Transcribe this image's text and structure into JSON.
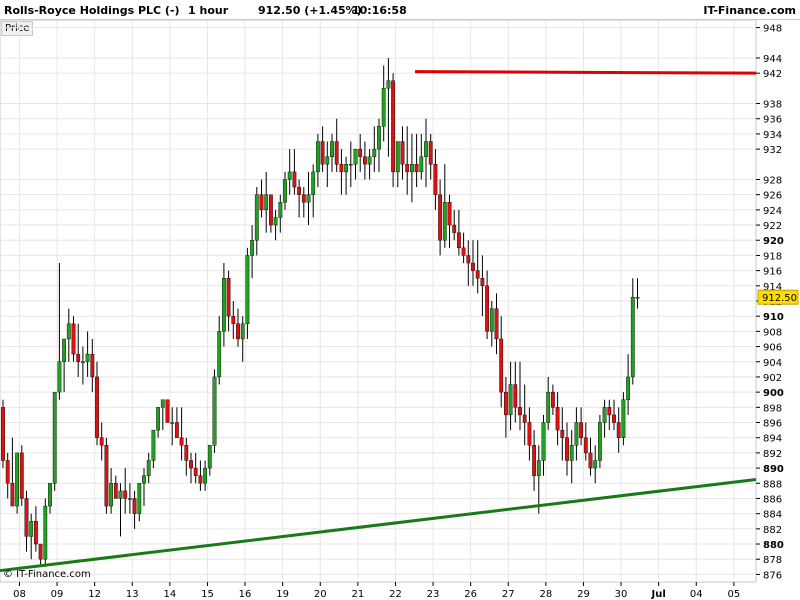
{
  "header": {
    "title": "Rolls-Royce Holdings PLC (-)",
    "interval": "1 hour",
    "last": "912.50 (+1.45%)",
    "time": "10:16:58",
    "brand": "IT-Finance.com"
  },
  "price_label": "Price",
  "copyright": "© IT-Finance.com",
  "colors": {
    "up": "#22a022",
    "down": "#dd1111",
    "wick": "#000000",
    "grid": "#e6e6e6",
    "resistance": "#e00000",
    "support": "#1a7a1a",
    "price_tag_bg": "#ffdd00"
  },
  "chart_data": {
    "type": "candlestick",
    "ylim": [
      875,
      949
    ],
    "current_price": 912.5,
    "current_price_label": "912.50",
    "y_ticks": [
      876,
      878,
      880,
      882,
      884,
      886,
      888,
      890,
      892,
      894,
      896,
      898,
      900,
      902,
      904,
      906,
      908,
      910,
      912,
      914,
      916,
      918,
      920,
      922,
      924,
      926,
      928,
      932,
      934,
      936,
      938,
      942,
      944,
      948
    ],
    "y_bold": [
      880,
      890,
      900,
      910,
      920
    ],
    "x_ticks": [
      {
        "label": "08",
        "idx": 3.5
      },
      {
        "label": "09",
        "idx": 11.5
      },
      {
        "label": "12",
        "idx": 19.5
      },
      {
        "label": "13",
        "idx": 27.5
      },
      {
        "label": "14",
        "idx": 35.5
      },
      {
        "label": "15",
        "idx": 43.5
      },
      {
        "label": "16",
        "idx": 51.5
      },
      {
        "label": "19",
        "idx": 59.5
      },
      {
        "label": "20",
        "idx": 67.5
      },
      {
        "label": "21",
        "idx": 75.5
      },
      {
        "label": "22",
        "idx": 83.5
      },
      {
        "label": "23",
        "idx": 91.5
      },
      {
        "label": "26",
        "idx": 99.5
      },
      {
        "label": "27",
        "idx": 107.5
      },
      {
        "label": "28",
        "idx": 115.5
      },
      {
        "label": "29",
        "idx": 123.5
      },
      {
        "label": "30",
        "idx": 131.5
      },
      {
        "label": "Jul",
        "idx": 139.5,
        "bold": true
      },
      {
        "label": "04",
        "idx": 147.5
      },
      {
        "label": "05",
        "idx": 155.5
      }
    ],
    "resistance": {
      "from_idx": 87,
      "to_idx": 159,
      "from_price": 942.2,
      "to_price": 942.0
    },
    "support": {
      "from_idx": 0,
      "to_idx": 159,
      "from_price": 876.5,
      "to_price": 888.5
    },
    "candles": [
      [
        898,
        899,
        890,
        891
      ],
      [
        891,
        892,
        886,
        888
      ],
      [
        888,
        894,
        885,
        885
      ],
      [
        885,
        892,
        884,
        892
      ],
      [
        892,
        893,
        885,
        886
      ],
      [
        886,
        887,
        879,
        881
      ],
      [
        881,
        884,
        878,
        883
      ],
      [
        883,
        885,
        879,
        880
      ],
      [
        880,
        880,
        877,
        878
      ],
      [
        878,
        886,
        877,
        885
      ],
      [
        885,
        888,
        884,
        888
      ],
      [
        888,
        900,
        887,
        900
      ],
      [
        900,
        917,
        899,
        904
      ],
      [
        904,
        907,
        900,
        907
      ],
      [
        907,
        911,
        904,
        909
      ],
      [
        909,
        910,
        904,
        905
      ],
      [
        905,
        909,
        902,
        904
      ],
      [
        904,
        906,
        901,
        904
      ],
      [
        904,
        908,
        902,
        905
      ],
      [
        905,
        907,
        900,
        902
      ],
      [
        902,
        904,
        893,
        894
      ],
      [
        894,
        896,
        891,
        893
      ],
      [
        893,
        894,
        884,
        885
      ],
      [
        885,
        890,
        884,
        888
      ],
      [
        888,
        889,
        886,
        886
      ],
      [
        886,
        888,
        881,
        887
      ],
      [
        887,
        890,
        884,
        886
      ],
      [
        886,
        888,
        884,
        886
      ],
      [
        886,
        887,
        882,
        884
      ],
      [
        884,
        888,
        883,
        888
      ],
      [
        888,
        890,
        885,
        889
      ],
      [
        889,
        892,
        888,
        891
      ],
      [
        891,
        895,
        890,
        895
      ],
      [
        895,
        898,
        894,
        898
      ],
      [
        898,
        899,
        895,
        899
      ],
      [
        899,
        899,
        896,
        896
      ],
      [
        896,
        898,
        893,
        896
      ],
      [
        896,
        898,
        894,
        894
      ],
      [
        894,
        898,
        891,
        893
      ],
      [
        893,
        894,
        889,
        891
      ],
      [
        891,
        892,
        888,
        890
      ],
      [
        890,
        892,
        888,
        889
      ],
      [
        889,
        891,
        887,
        888
      ],
      [
        888,
        891,
        887,
        890
      ],
      [
        890,
        893,
        889,
        893
      ],
      [
        893,
        903,
        892,
        902
      ],
      [
        902,
        910,
        901,
        908
      ],
      [
        908,
        917,
        906,
        915
      ],
      [
        915,
        916,
        908,
        910
      ],
      [
        910,
        912,
        907,
        909
      ],
      [
        909,
        911,
        906,
        907
      ],
      [
        907,
        910,
        904,
        909
      ],
      [
        909,
        919,
        907,
        918
      ],
      [
        918,
        922,
        915,
        920
      ],
      [
        920,
        927,
        918,
        926
      ],
      [
        926,
        928,
        923,
        924
      ],
      [
        924,
        929,
        921,
        926
      ],
      [
        926,
        926,
        921,
        922
      ],
      [
        922,
        924,
        920,
        923
      ],
      [
        923,
        926,
        921,
        925
      ],
      [
        925,
        929,
        924,
        928
      ],
      [
        928,
        932,
        926,
        929
      ],
      [
        929,
        932,
        926,
        927
      ],
      [
        927,
        928,
        923,
        926
      ],
      [
        926,
        927,
        923,
        925
      ],
      [
        925,
        929,
        922,
        926
      ],
      [
        926,
        930,
        923,
        929
      ],
      [
        929,
        934,
        927,
        933
      ],
      [
        933,
        935,
        929,
        930
      ],
      [
        930,
        933,
        927,
        931
      ],
      [
        931,
        934,
        929,
        933
      ],
      [
        933,
        936,
        929,
        930
      ],
      [
        930,
        932,
        926,
        929
      ],
      [
        929,
        931,
        926,
        930
      ],
      [
        930,
        933,
        927,
        930
      ],
      [
        930,
        932,
        928,
        932
      ],
      [
        932,
        934,
        929,
        931
      ],
      [
        931,
        933,
        928,
        930
      ],
      [
        930,
        932,
        928,
        931
      ],
      [
        931,
        935,
        929,
        932
      ],
      [
        932,
        936,
        929,
        935
      ],
      [
        935,
        943,
        933,
        940
      ],
      [
        940,
        944,
        931,
        941
      ],
      [
        941,
        942,
        927,
        929
      ],
      [
        929,
        930,
        927,
        933
      ],
      [
        933,
        935,
        928,
        930
      ],
      [
        930,
        935,
        926,
        929
      ],
      [
        929,
        934,
        925,
        930
      ],
      [
        930,
        934,
        927,
        929
      ],
      [
        929,
        934,
        928,
        931
      ],
      [
        931,
        936,
        927,
        933
      ],
      [
        933,
        934,
        928,
        930
      ],
      [
        930,
        932,
        924,
        926
      ],
      [
        926,
        928,
        918,
        920
      ],
      [
        920,
        930,
        919,
        925
      ],
      [
        925,
        926,
        919,
        922
      ],
      [
        922,
        924,
        920,
        921
      ],
      [
        921,
        924,
        918,
        919
      ],
      [
        919,
        921,
        917,
        918
      ],
      [
        918,
        920,
        914,
        917
      ],
      [
        917,
        920,
        914,
        916
      ],
      [
        916,
        920,
        913,
        915
      ],
      [
        915,
        918,
        910,
        914
      ],
      [
        914,
        916,
        907,
        908
      ],
      [
        908,
        912,
        906,
        911
      ],
      [
        911,
        913,
        905,
        907
      ],
      [
        907,
        910,
        898,
        900
      ],
      [
        900,
        902,
        894,
        897
      ],
      [
        897,
        904,
        895,
        901
      ],
      [
        901,
        904,
        896,
        898
      ],
      [
        898,
        904,
        895,
        897
      ],
      [
        897,
        901,
        893,
        896
      ],
      [
        896,
        898,
        891,
        893
      ],
      [
        893,
        895,
        887,
        889
      ],
      [
        889,
        893,
        884,
        891
      ],
      [
        891,
        897,
        889,
        896
      ],
      [
        896,
        902,
        895,
        900
      ],
      [
        900,
        901,
        897,
        898
      ],
      [
        898,
        900,
        893,
        895
      ],
      [
        895,
        898,
        891,
        894
      ],
      [
        894,
        896,
        889,
        891
      ],
      [
        891,
        895,
        888,
        893
      ],
      [
        893,
        898,
        891,
        896
      ],
      [
        896,
        898,
        893,
        894
      ],
      [
        894,
        896,
        891,
        892
      ],
      [
        892,
        894,
        889,
        890
      ],
      [
        890,
        893,
        888,
        891
      ],
      [
        891,
        897,
        890,
        896
      ],
      [
        896,
        899,
        894,
        898
      ],
      [
        898,
        899,
        895,
        897
      ],
      [
        897,
        899,
        895,
        896
      ],
      [
        896,
        898,
        892,
        894
      ],
      [
        894,
        900,
        893,
        899
      ],
      [
        899,
        905,
        897,
        902
      ],
      [
        902,
        915,
        901,
        912.5
      ],
      [
        912.5,
        915,
        911,
        912.5
      ]
    ]
  }
}
